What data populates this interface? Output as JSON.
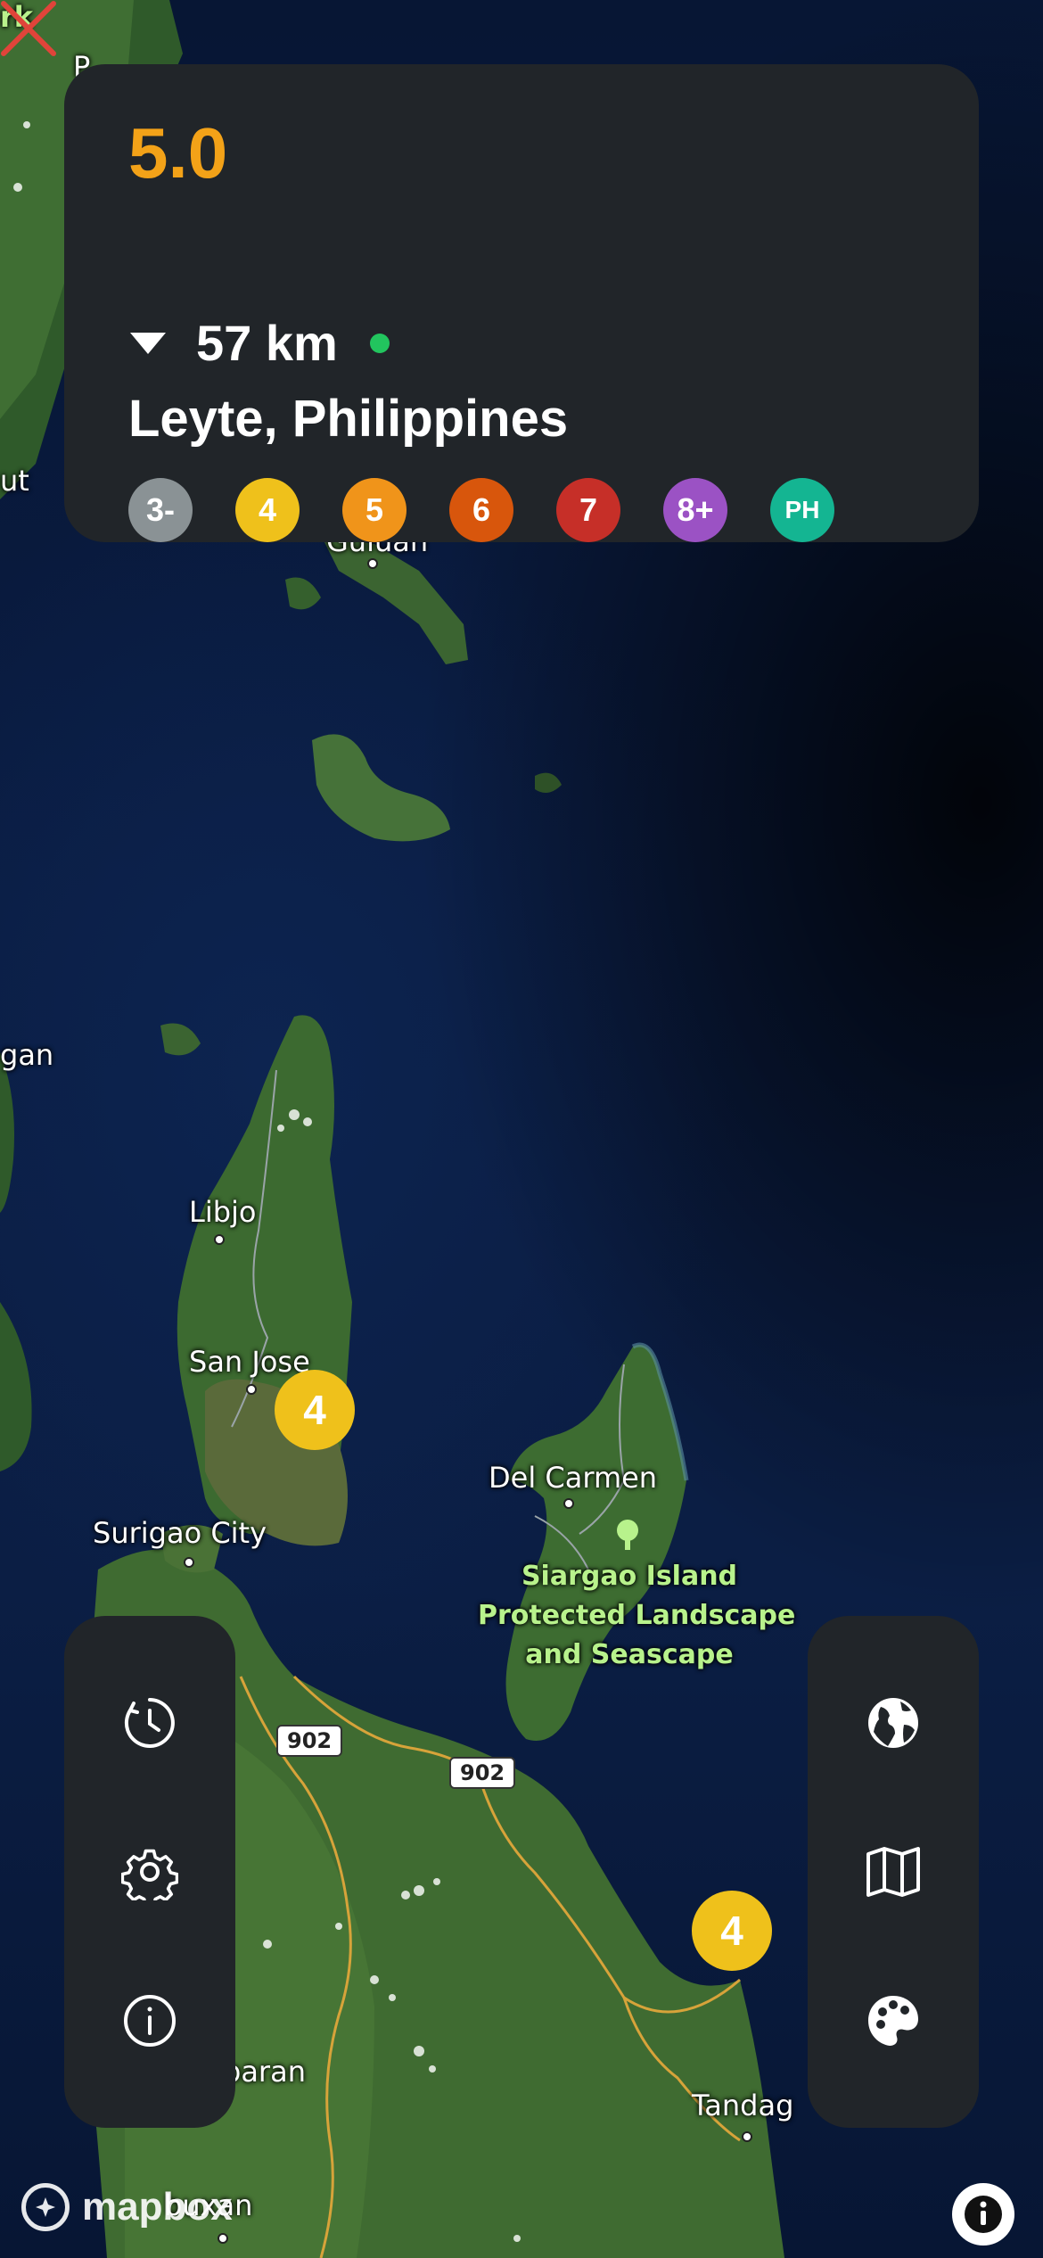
{
  "info_card": {
    "magnitude": "5.0",
    "depth": "57 km",
    "location": "Leyte, Philippines",
    "legend": [
      {
        "label": "3-",
        "color": "#8a9295"
      },
      {
        "label": "4",
        "color": "#efc11b"
      },
      {
        "label": "5",
        "color": "#f0941a"
      },
      {
        "label": "6",
        "color": "#d8560c"
      },
      {
        "label": "7",
        "color": "#c62f28"
      },
      {
        "label": "8+",
        "color": "#9b52c4"
      },
      {
        "label": "PH",
        "color": "#14b592"
      }
    ],
    "magnitude_color": "#f3a218",
    "live_indicator_color": "#22c55e"
  },
  "map": {
    "places": {
      "libjo": "Libjo",
      "san_jose": "San Jose",
      "surigao_city": "Surigao City",
      "del_carmen": "Del Carmen",
      "park_line1": "Siargao Island",
      "park_line2": "Protected Landscape",
      "park_line3": "and Seascape",
      "tandag": "Tandag",
      "baran": "baran",
      "guiuan": "Guiuan",
      "left_gan": "gan",
      "left_ut": "ut",
      "left_p": "P",
      "left_rk": "rk",
      "buenavista": "buxan"
    },
    "road_shields": [
      "902",
      "902"
    ],
    "clusters": [
      "4",
      "4"
    ],
    "epicenter_icon": "epicenter-x-icon"
  },
  "left_panel": {
    "icons": [
      "history-clock-icon",
      "settings-gear-icon",
      "info-icon"
    ]
  },
  "right_panel": {
    "icons": [
      "globe-icon",
      "map-icon",
      "palette-icon"
    ]
  },
  "footer": {
    "mapbox_text": "mapbox",
    "attribution_icon": "info-icon"
  }
}
